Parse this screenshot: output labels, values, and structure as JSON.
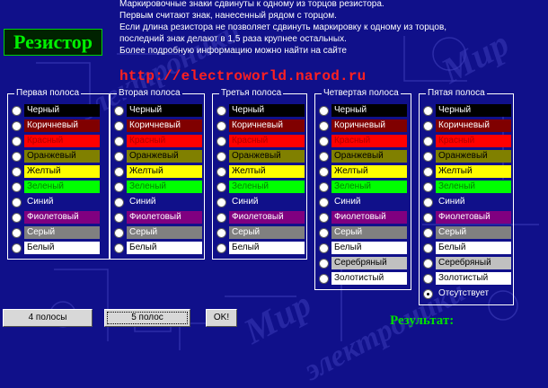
{
  "notes": [
    "Маркировочные знаки сдвинуты к одному из торцов резистора.",
    "Первым считают знак, нанесенный рядом с торцом.",
    "Если длина резистора не позволяет сдвинуть маркировку к одному из торцов,",
    "последний знак делают в 1,5 раза крупнее остальных.",
    "Более подробную информацию можно найти на сайте"
  ],
  "logo": "Резистор",
  "url": "http://electroworld.narod.ru",
  "background_text": [
    "Мир",
    "электроники"
  ],
  "groups": [
    {
      "legend": "Первая полоса",
      "options": [
        {
          "label": "Черный",
          "color": "#000000",
          "text": "#ffffff"
        },
        {
          "label": "Коричневый",
          "color": "#800000",
          "text": "#ffffff"
        },
        {
          "label": "Красный",
          "color": "#ff0000",
          "text": "#b00000"
        },
        {
          "label": "Оранжевый",
          "color": "#808000",
          "text": "#000000"
        },
        {
          "label": "Желтый",
          "color": "#ffff00",
          "text": "#000000"
        },
        {
          "label": "Зеленый",
          "color": "#00ff00",
          "text": "#008000"
        },
        {
          "label": "Синий",
          "color": "#10108a",
          "text": "#ffffff"
        },
        {
          "label": "Фиолетовый",
          "color": "#800080",
          "text": "#ffffff"
        },
        {
          "label": "Серый",
          "color": "#808080",
          "text": "#ffffff"
        },
        {
          "label": "Белый",
          "color": "#ffffff",
          "text": "#000000"
        }
      ]
    },
    {
      "legend": "Вторая полоса",
      "options": [
        {
          "label": "Черный",
          "color": "#000000",
          "text": "#ffffff"
        },
        {
          "label": "Коричневый",
          "color": "#800000",
          "text": "#ffffff"
        },
        {
          "label": "Красный",
          "color": "#ff0000",
          "text": "#b00000"
        },
        {
          "label": "Оранжевый",
          "color": "#808000",
          "text": "#000000"
        },
        {
          "label": "Желтый",
          "color": "#ffff00",
          "text": "#000000"
        },
        {
          "label": "Зеленый",
          "color": "#00ff00",
          "text": "#008000"
        },
        {
          "label": "Синий",
          "color": "#10108a",
          "text": "#ffffff"
        },
        {
          "label": "Фиолетовый",
          "color": "#800080",
          "text": "#ffffff"
        },
        {
          "label": "Серый",
          "color": "#808080",
          "text": "#ffffff"
        },
        {
          "label": "Белый",
          "color": "#ffffff",
          "text": "#000000"
        }
      ]
    },
    {
      "legend": "Третья полоса",
      "options": [
        {
          "label": "Черный",
          "color": "#000000",
          "text": "#ffffff"
        },
        {
          "label": "Коричневый",
          "color": "#800000",
          "text": "#ffffff"
        },
        {
          "label": "Красный",
          "color": "#ff0000",
          "text": "#b00000"
        },
        {
          "label": "Оранжевый",
          "color": "#808000",
          "text": "#000000"
        },
        {
          "label": "Желтый",
          "color": "#ffff00",
          "text": "#000000"
        },
        {
          "label": "Зеленый",
          "color": "#00ff00",
          "text": "#008000"
        },
        {
          "label": "Синий",
          "color": "#10108a",
          "text": "#ffffff"
        },
        {
          "label": "Фиолетовый",
          "color": "#800080",
          "text": "#ffffff"
        },
        {
          "label": "Серый",
          "color": "#808080",
          "text": "#ffffff"
        },
        {
          "label": "Белый",
          "color": "#ffffff",
          "text": "#000000"
        }
      ]
    },
    {
      "legend": "Четвертая полоса",
      "options": [
        {
          "label": "Черный",
          "color": "#000000",
          "text": "#ffffff"
        },
        {
          "label": "Коричневый",
          "color": "#800000",
          "text": "#ffffff"
        },
        {
          "label": "Красный",
          "color": "#ff0000",
          "text": "#b00000"
        },
        {
          "label": "Оранжевый",
          "color": "#808000",
          "text": "#000000"
        },
        {
          "label": "Желтый",
          "color": "#ffff00",
          "text": "#000000"
        },
        {
          "label": "Зеленый",
          "color": "#00ff00",
          "text": "#008000"
        },
        {
          "label": "Синий",
          "color": "#10108a",
          "text": "#ffffff"
        },
        {
          "label": "Фиолетовый",
          "color": "#800080",
          "text": "#ffffff"
        },
        {
          "label": "Серый",
          "color": "#808080",
          "text": "#ffffff"
        },
        {
          "label": "Белый",
          "color": "#ffffff",
          "text": "#000000"
        },
        {
          "label": "Серебряный",
          "color": "#c0c0c0",
          "text": "#000000"
        },
        {
          "label": "Золотистый",
          "color": "#ffffff",
          "text": "#000000"
        }
      ]
    },
    {
      "legend": "Пятая полоса",
      "options": [
        {
          "label": "Черный",
          "color": "#000000",
          "text": "#ffffff"
        },
        {
          "label": "Коричневый",
          "color": "#800000",
          "text": "#ffffff"
        },
        {
          "label": "Красный",
          "color": "#ff0000",
          "text": "#b00000"
        },
        {
          "label": "Оранжевый",
          "color": "#808000",
          "text": "#000000"
        },
        {
          "label": "Желтый",
          "color": "#ffff00",
          "text": "#000000"
        },
        {
          "label": "Зеленый",
          "color": "#00ff00",
          "text": "#008000"
        },
        {
          "label": "Синий",
          "color": "#10108a",
          "text": "#ffffff"
        },
        {
          "label": "Фиолетовый",
          "color": "#800080",
          "text": "#ffffff"
        },
        {
          "label": "Серый",
          "color": "#808080",
          "text": "#ffffff"
        },
        {
          "label": "Белый",
          "color": "#ffffff",
          "text": "#000000"
        },
        {
          "label": "Серебряный",
          "color": "#c0c0c0",
          "text": "#000000"
        },
        {
          "label": "Золотистый",
          "color": "#ffffff",
          "text": "#000000"
        },
        {
          "label": "Отсутствует",
          "color": "transparent",
          "text": "#ffffff",
          "selected": true
        }
      ]
    }
  ],
  "buttons": {
    "four_bands": "4 полосы",
    "five_bands": "5 полос",
    "ok": "OK!"
  },
  "result_label": "Результат:"
}
